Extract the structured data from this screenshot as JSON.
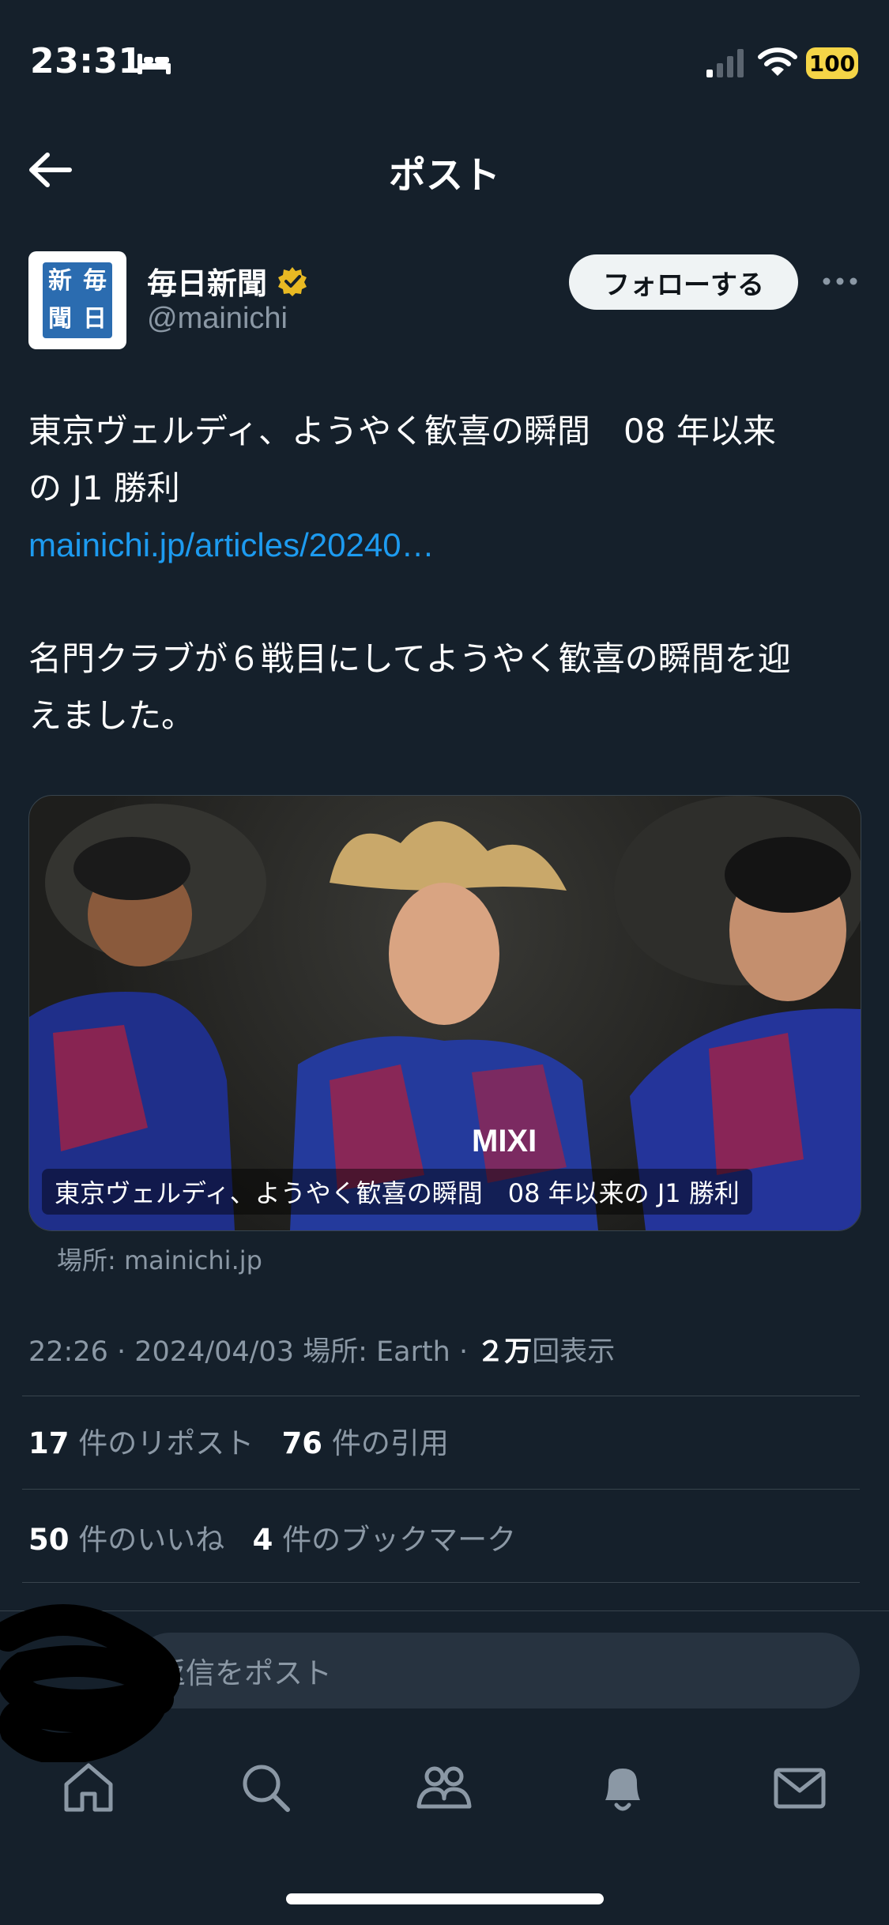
{
  "status_bar": {
    "time": "23:31",
    "battery": "100"
  },
  "header": {
    "title": "ポスト"
  },
  "author": {
    "name": "毎日新聞",
    "handle": "@mainichi",
    "avatar_chars": [
      "新",
      "毎",
      "聞",
      "日"
    ],
    "follow_label": "フォローする"
  },
  "post": {
    "line1": "東京ヴェルディ、ようやく歓喜の瞬間　08 年以来",
    "line2": "の J1 勝利",
    "link": "mainichi.jp/articles/20240…",
    "line3": "名門クラブが６戦目にしてようやく歓喜の瞬間を迎",
    "line4": "えました。"
  },
  "media": {
    "caption": "東京ヴェルディ、ようやく歓喜の瞬間　08 年以来の J1 勝利",
    "source": "場所: mainichi.jp"
  },
  "meta": {
    "timestamp": "22:26 · 2024/04/03 場所: Earth · ",
    "views_count": "２万",
    "views_label": "回表示"
  },
  "stats": {
    "reposts_count": "17",
    "reposts_label": "件のリポスト",
    "quotes_count": "76",
    "quotes_label": "件の引用",
    "likes_count": "50",
    "likes_label": "件のいいね",
    "bookmarks_count": "4",
    "bookmarks_label": "件のブックマーク"
  },
  "reply": {
    "placeholder": "返信をポスト"
  },
  "colors": {
    "background": "#15202b",
    "link": "#1d9bf0",
    "muted": "#8b98a5",
    "battery": "#f5d547",
    "verified": "#e8b923"
  },
  "tab_bar": {
    "icons": [
      "home-icon",
      "search-icon",
      "communities-icon",
      "notifications-icon",
      "messages-icon"
    ]
  }
}
